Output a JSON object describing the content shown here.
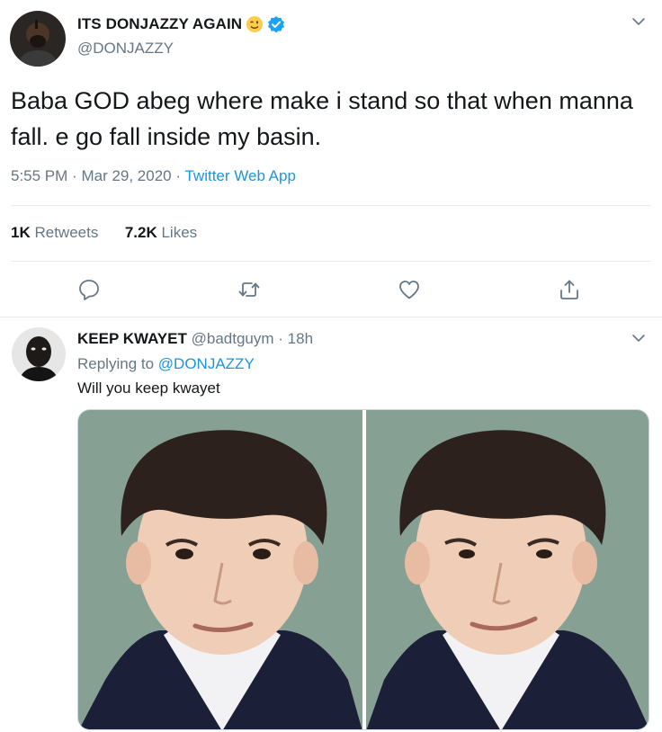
{
  "tweet": {
    "author_name": "ITS DONJAZZY AGAIN",
    "author_handle": "@DONJAZZY",
    "text": "Baba GOD abeg where make i stand so that when manna fall. e go fall inside my basin.",
    "time": "5:55 PM",
    "date": "Mar 29, 2020",
    "separator": "·",
    "source": "Twitter Web App",
    "retweets_count": "1K",
    "retweets_label": "Retweets",
    "likes_count": "7.2K",
    "likes_label": "Likes",
    "icons": {
      "name_emoji": "winking-face-emoji",
      "verified": "verified-badge-icon",
      "menu": "chevron-down-icon",
      "actions": [
        "reply-icon",
        "retweet-icon",
        "like-icon",
        "share-icon"
      ]
    }
  },
  "reply": {
    "author_name": "KEEP KWAYET",
    "author_handle": "@badtguym",
    "separator": "·",
    "time_ago": "18h",
    "replying_label": "Replying to",
    "replying_handle": "@DONJAZZY",
    "text": "Will you keep kwayet",
    "media_type": "two side-by-side photos",
    "icons": {
      "menu": "chevron-down-icon"
    }
  },
  "colors": {
    "text": "#14171a",
    "muted": "#657786",
    "link": "#1b95e0",
    "verified": "#1da1f2",
    "divider": "#e6ecf0"
  }
}
